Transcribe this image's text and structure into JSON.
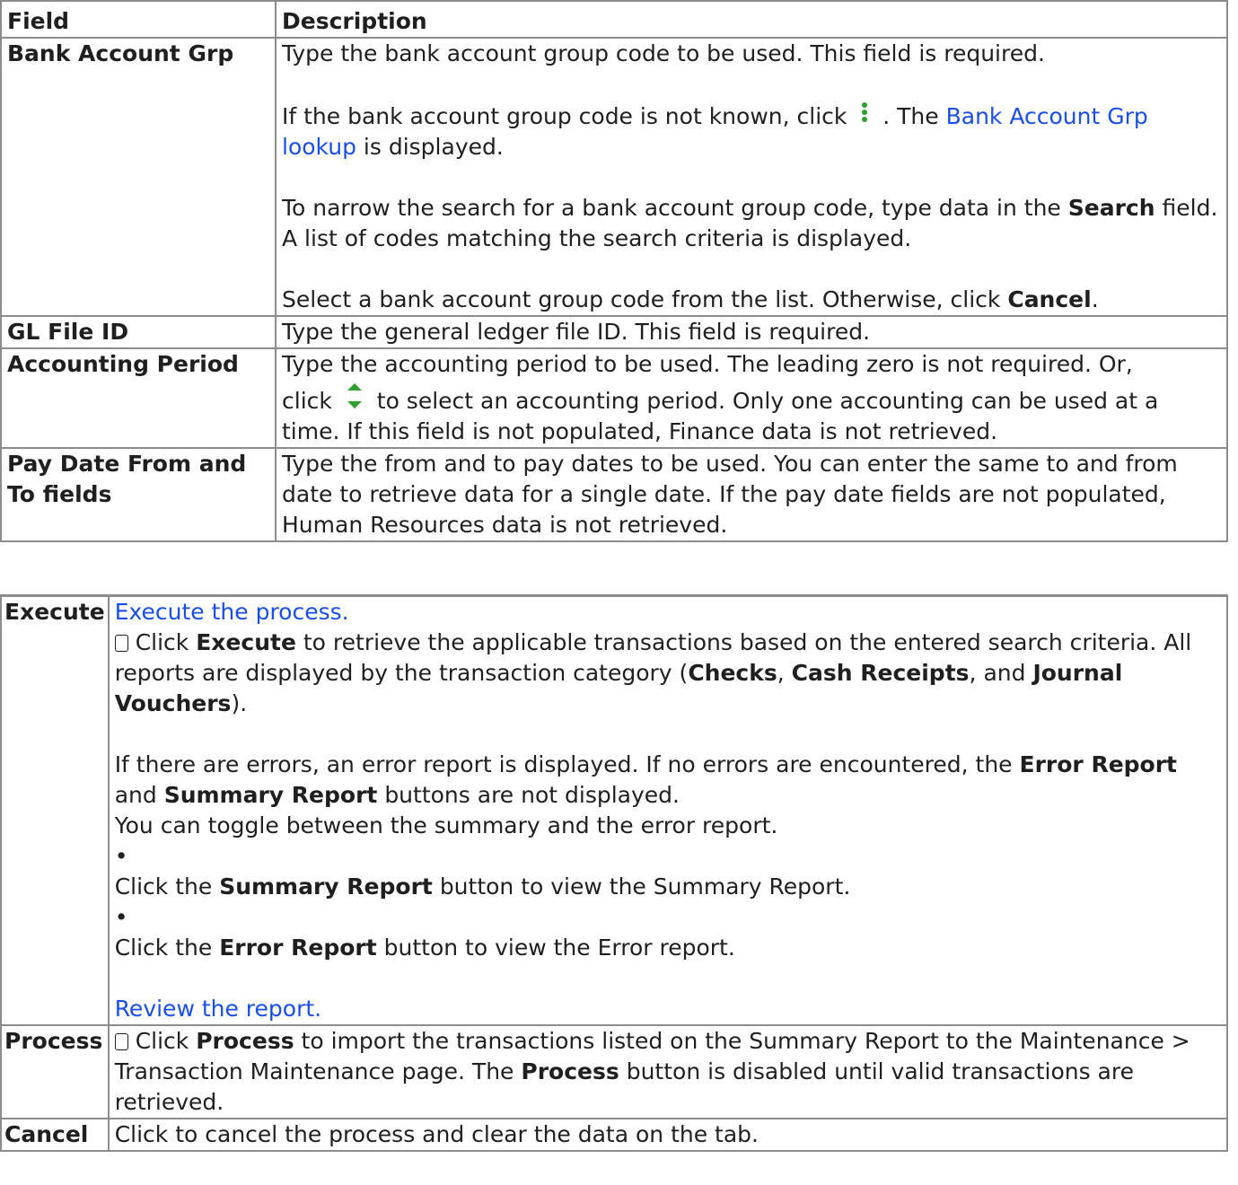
{
  "table": {
    "header": {
      "field": "Field",
      "description": "Description"
    },
    "bank": {
      "field": "Bank Account Grp",
      "p1": "Type the bank account group code to be used. This field is required.",
      "p2_pre": "If the bank account group code is not known, click",
      "p2_mid": ". The",
      "p2_link": "Bank Account Grp lookup",
      "p2_post": "is displayed.",
      "p3_pre": "To narrow the search for a bank account group code, type data in the",
      "p3_bold": "Search",
      "p3_post": "field. A list of codes matching the search criteria is displayed.",
      "p4_pre": "Select a bank account group code from the list. Otherwise, click",
      "p4_bold": "Cancel",
      "p4_post": "."
    },
    "gl": {
      "field": "GL File ID",
      "desc": "Type the general ledger file ID. This field is required."
    },
    "period": {
      "field": "Accounting Period",
      "d1": "Type the accounting period to be used. The leading zero is not required. Or,",
      "d2_pre": "click",
      "d2_post": "to select an accounting period. Only one accounting can be used at a time. If this field is not populated, Finance data is not retrieved."
    },
    "paydate": {
      "field": "Pay Date From and To fields",
      "desc": "Type the from and to pay dates to be used. You can enter the same to and from date to retrieve data for a single date. If the pay date fields are not populated, Human Resources data is not retrieved."
    }
  },
  "buttons": {
    "execute": {
      "field": "Execute",
      "link1": "Execute the process.",
      "c_pre": "Click",
      "c_b1": "Execute",
      "c_mid": "to retrieve the applicable transactions based on the entered search criteria. All reports are displayed by the transaction category (",
      "c_b2": "Checks",
      "c_sep1": ",",
      "c_b3": "Cash Receipts",
      "c_sep2": ", and",
      "c_b4": "Journal Vouchers",
      "c_end": ").",
      "e_pre": "If there are errors, an error report is displayed. If no errors are encountered, the",
      "e_b1": "Error Report",
      "e_mid": "and",
      "e_b2": "Summary Report",
      "e_post": "buttons are not displayed.",
      "toggle": "You can toggle between the summary and the error report.",
      "bullet": "•",
      "s_pre": "Click the",
      "s_b": "Summary Report",
      "s_post": "button to view the Summary Report.",
      "r_pre": "Click the",
      "r_b": "Error Report",
      "r_post": "button to view the Error report.",
      "link2": "Review the report."
    },
    "process": {
      "field": "Process",
      "pre": "Click",
      "b1": "Process",
      "mid": "to import the transactions listed on the Summary Report to the Maintenance > Transaction Maintenance page. The",
      "b2": "Process",
      "post": "button is disabled until valid transactions are retrieved."
    },
    "cancel": {
      "field": "Cancel",
      "desc": "Click to cancel the process and clear the data on the tab."
    }
  },
  "colors": {
    "link": "#1a4ee8",
    "icon_green": "#2e9e2e",
    "border": "#8c8c8c"
  }
}
